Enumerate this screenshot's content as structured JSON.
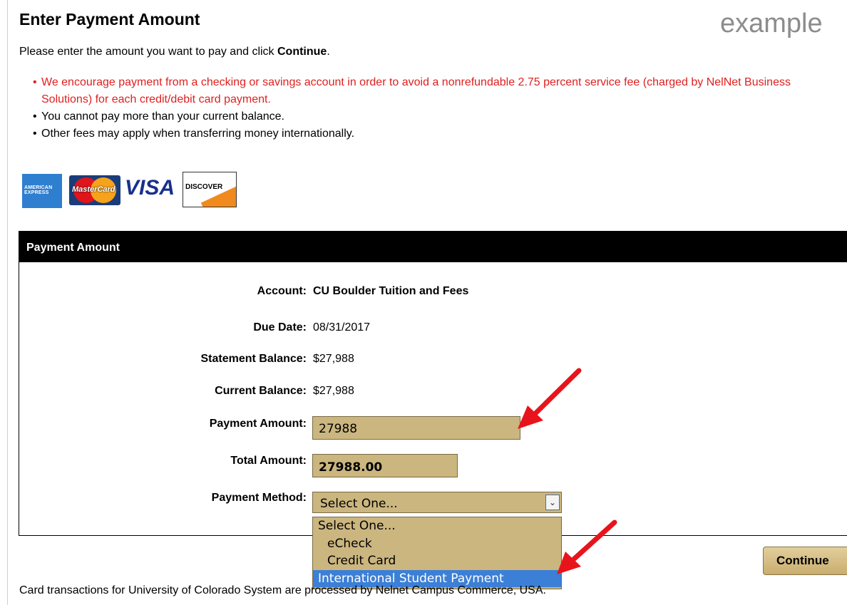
{
  "header": {
    "title": "Enter Payment Amount",
    "watermark": "example",
    "intro_prefix": "Please enter the amount you want to pay and click ",
    "intro_bold": "Continue",
    "intro_suffix": "."
  },
  "notes": [
    "We encourage payment from a checking or savings account in order to avoid a nonrefundable 2.75 percent service fee (charged by NelNet Business Solutions) for each credit/debit card payment.",
    "You cannot pay more than your current balance.",
    "Other fees may apply when transferring money internationally."
  ],
  "card_logos": {
    "amex": "AMERICAN EXPRESS",
    "mastercard": "MasterCard",
    "visa": "VISA",
    "discover": "DISCOVER"
  },
  "panel": {
    "title": "Payment Amount",
    "account_label": "Account:",
    "account_value": "CU Boulder Tuition and Fees",
    "due_date_label": "Due Date:",
    "due_date_value": "08/31/2017",
    "statement_label": "Statement Balance:",
    "statement_value": "$27,988",
    "current_label": "Current Balance:",
    "current_value": "$27,988",
    "payment_amount_label": "Payment Amount:",
    "payment_amount_value": "27988",
    "total_label": "Total Amount:",
    "total_value": "27988.00",
    "method_label": "Payment Method:",
    "method_selected": "Select One...",
    "method_options": [
      "Select One...",
      "eCheck",
      "Credit Card",
      "International Student Payment"
    ]
  },
  "continue_label": "Continue",
  "footer": "Card transactions for University of Colorado System are processed by Nelnet Campus Commerce, USA.",
  "colors": {
    "field_bg": "#cbb67f",
    "warning_text": "#e01f1f",
    "highlight": "#3c7fd6",
    "annotation_arrow": "#e8141b"
  }
}
